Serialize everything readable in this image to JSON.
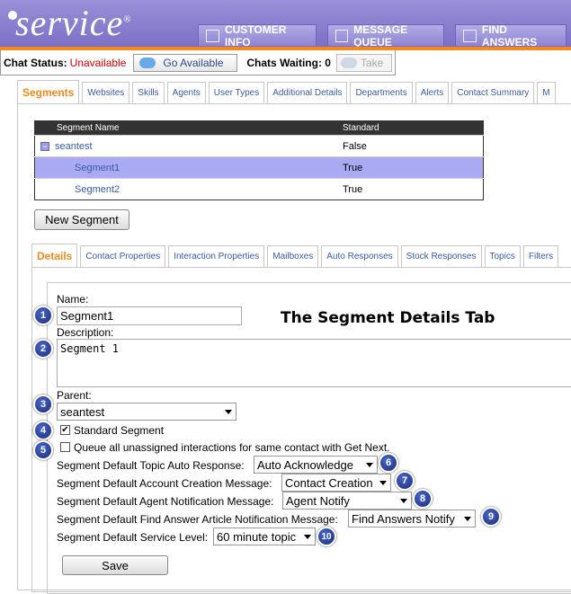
{
  "header": {
    "logo_text": "service",
    "logo_mark": "®",
    "nav": [
      {
        "label": "CUSTOMER INFO",
        "icon": "users-icon"
      },
      {
        "label": "MESSAGE QUEUE",
        "icon": "document-stack-icon"
      },
      {
        "label": "FIND ANSWERS",
        "icon": "book-icon"
      }
    ],
    "colors": {
      "header": "#8a7fcf",
      "accent": "#f08a1c",
      "link": "#3a5ba0",
      "status_red": "#cc0000",
      "selected_row": "#a9a9f4"
    }
  },
  "chat": {
    "status_label": "Chat Status:",
    "status_value": "Unavailable",
    "go_available_label": "Go Available",
    "waiting_label": "Chats Waiting: 0",
    "take_label": "Take"
  },
  "top_tabs": [
    "Segments",
    "Websites",
    "Skills",
    "Agents",
    "User Types",
    "Additional Details",
    "Departments",
    "Alerts",
    "Contact Summary",
    "M"
  ],
  "segments_table": {
    "headers": [
      "Segment Name",
      "Standard"
    ],
    "rows": [
      {
        "name": "seantest",
        "standard": "False",
        "expander": "−"
      },
      {
        "name": "Segment1",
        "standard": "True"
      },
      {
        "name": "Segment2",
        "standard": "True"
      }
    ]
  },
  "new_segment_label": "New Segment",
  "detail_tabs": [
    "Details",
    "Contact Properties",
    "Interaction Properties",
    "Mailboxes",
    "Auto Responses",
    "Stock Responses",
    "Topics",
    "Filters"
  ],
  "details": {
    "title": "The Segment Details Tab",
    "name_label": "Name:",
    "name_value": "Segment1",
    "description_label": "Description:",
    "description_value": "Segment 1",
    "parent_label": "Parent:",
    "parent_value": "seantest",
    "standard_label": "Standard Segment",
    "standard_checked": "✔",
    "queue_label": "Queue all unassigned interactions for same contact with Get Next.",
    "topic_label": "Segment Default Topic Auto Response:",
    "topic_value": "Auto Acknowledge",
    "account_label": "Segment Default Account Creation Message:",
    "account_value": "Contact Creation",
    "agent_label": "Segment Default Agent Notification Message:",
    "agent_value": "Agent Notify",
    "find_label": "Segment Default Find Answer Article Notification Message:",
    "find_value": "Find Answers Notify",
    "service_label": "Segment Default Service Level:",
    "service_value": "60 minute topic",
    "save_label": "Save"
  },
  "callouts": [
    "1",
    "2",
    "3",
    "4",
    "5",
    "6",
    "7",
    "8",
    "9",
    "10"
  ]
}
